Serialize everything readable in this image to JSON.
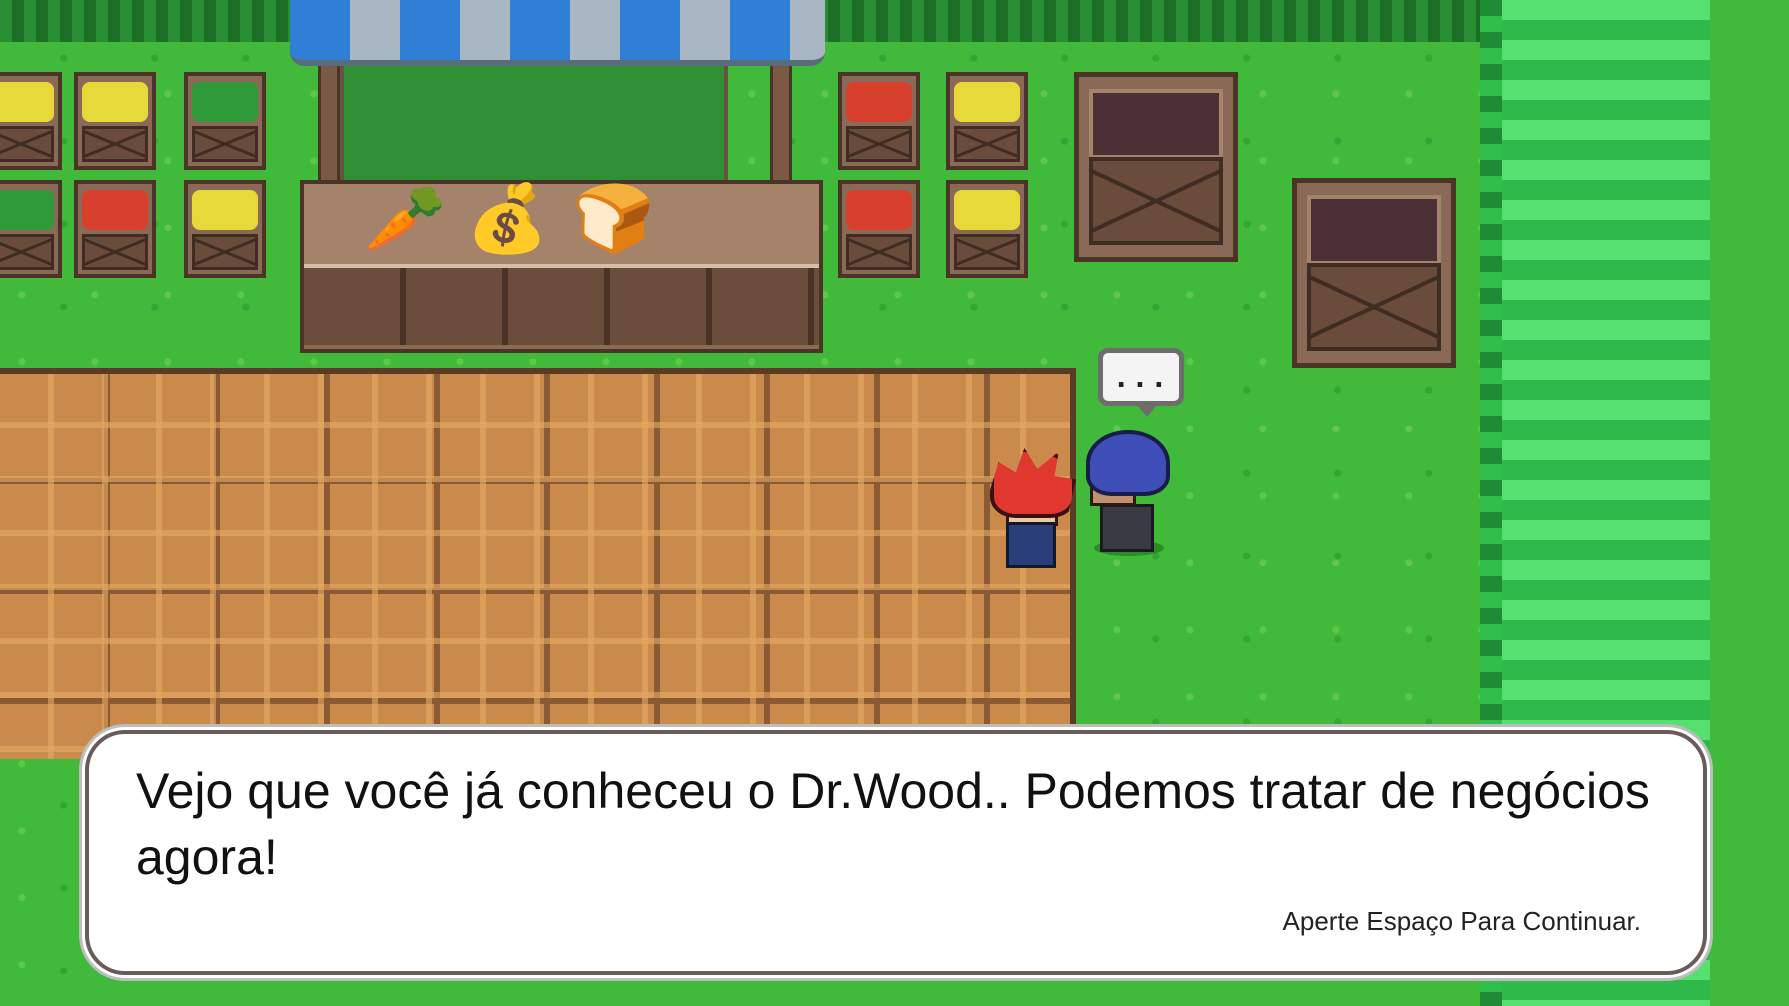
{
  "dialog": {
    "message": "Vejo que você já conheceu o Dr.Wood.. Podemos tratar de negócios agora!",
    "hint": "Aperte Espaço Para Continuar."
  },
  "speech_bubble": {
    "text": "..."
  },
  "shop_items": [
    {
      "name": "carrot-icon",
      "glyph": "🥕"
    },
    {
      "name": "sack-icon",
      "glyph": "💰"
    },
    {
      "name": "bread-icon",
      "glyph": "🍞"
    }
  ],
  "colors": {
    "grass": "#41b93b",
    "path": "#c98a4c",
    "hero_hair": "#e0382e",
    "npc_hair": "#3f4fb8",
    "dialog_bg": "#ffffff"
  }
}
